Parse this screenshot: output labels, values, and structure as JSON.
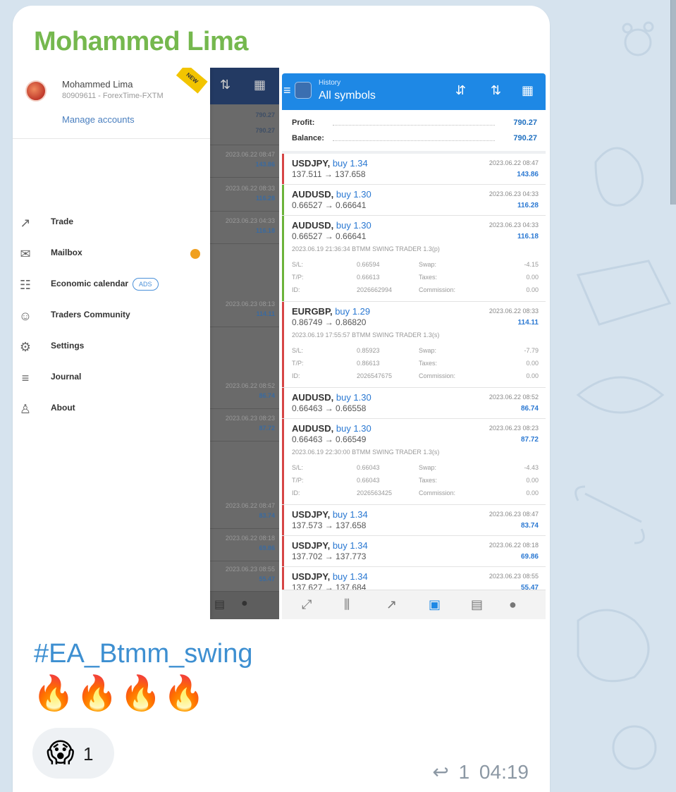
{
  "message": {
    "sender": "Mohammed Lima",
    "hashtag": "#EA_Btmm_swing",
    "emoji_line": "🔥🔥🔥🔥",
    "reaction": {
      "emoji": "😱",
      "count": "1"
    },
    "reply_icon": "↩",
    "reply_count": "1",
    "time": "04:19"
  },
  "left_screen": {
    "account": {
      "name": "Mohammed Lima",
      "number": "80909611 - ForexTime-FXTM",
      "manage_label": "Manage accounts",
      "corner_badge": "NEW"
    },
    "menu": [
      {
        "icon": "trade-icon",
        "glyph": "↗",
        "label": "Trade"
      },
      {
        "icon": "mailbox-icon",
        "glyph": "✉",
        "label": "Mailbox"
      },
      {
        "icon": "economic-calendar-icon",
        "glyph": "☷",
        "label": "Economic calendar",
        "pill": "ADS"
      },
      {
        "icon": "traders-community-icon",
        "glyph": "☺",
        "label": "Traders Community"
      },
      {
        "icon": "settings-icon",
        "glyph": "⚙",
        "label": "Settings"
      },
      {
        "icon": "journal-icon",
        "glyph": "≡",
        "label": "Journal"
      },
      {
        "icon": "about-icon",
        "glyph": "♙",
        "label": "About"
      }
    ],
    "background_values": {
      "profit": "790.27",
      "balance": "790.27",
      "rows": [
        {
          "time": "2023.06.22 08:47",
          "value": "143.86"
        },
        {
          "time": "2023.06.22 08:33",
          "value": "116.28"
        },
        {
          "time": "2023.06.23 04:33",
          "value": "116.18"
        },
        {
          "time": "2023.06.23 08:13",
          "value": "114.11"
        },
        {
          "time": "2023.06.22 08:52",
          "value": "86.74"
        },
        {
          "time": "2023.06.23 08:23",
          "value": "87.72"
        },
        {
          "time": "2023.06.22 08:47",
          "value": "83.74"
        },
        {
          "time": "2023.06.22 08:18",
          "value": "69.86"
        },
        {
          "time": "2023.06.23 08:55",
          "value": "55.47"
        }
      ]
    }
  },
  "right_screen": {
    "header": {
      "subtitle": "History",
      "title": "All symbols"
    },
    "summary": [
      {
        "label": "Profit:",
        "value": "790.27"
      },
      {
        "label": "Balance:",
        "value": "790.27"
      }
    ],
    "trades": [
      {
        "symbol": "USDJPY,",
        "side": "buy 1.34",
        "prices": "137.511 → 137.658",
        "time": "2023.06.22 08:47",
        "profit": "143.86",
        "bar": "#d64545"
      },
      {
        "symbol": "AUDUSD,",
        "side": "buy 1.30",
        "prices": "0.66527 → 0.66641",
        "time": "2023.06.23 04:33",
        "profit": "116.28",
        "bar": "#6bb33a"
      },
      {
        "symbol": "AUDUSD,",
        "side": "buy 1.30",
        "prices": "0.66527 → 0.66641",
        "time": "2023.06.23 04:33",
        "profit": "116.18",
        "bar": "#6bb33a",
        "comment": "2023.06.19 21:36:34 BTMM SWING TRADER 1.3(p)",
        "details": [
          [
            "S/L:",
            "0.66594",
            "Swap:",
            "-4.15"
          ],
          [
            "T/P:",
            "0.66613",
            "Taxes:",
            "0.00"
          ],
          [
            "ID:",
            "2026662994",
            "Commission:",
            "0.00"
          ]
        ]
      },
      {
        "symbol": "EURGBP,",
        "side": "buy 1.29",
        "prices": "0.86749 → 0.86820",
        "time": "2023.06.22 08:33",
        "profit": "114.11",
        "bar": "#d64545",
        "comment": "2023.06.19 17:55:57 BTMM SWING TRADER 1.3(s)",
        "details": [
          [
            "S/L:",
            "0.85923",
            "Swap:",
            "-7.79"
          ],
          [
            "T/P:",
            "0.86613",
            "Taxes:",
            "0.00"
          ],
          [
            "ID:",
            "2026547675",
            "Commission:",
            "0.00"
          ]
        ]
      },
      {
        "symbol": "AUDUSD,",
        "side": "buy 1.30",
        "prices": "0.66463 → 0.66558",
        "time": "2023.06.22 08:52",
        "profit": "86.74",
        "bar": "#d64545"
      },
      {
        "symbol": "AUDUSD,",
        "side": "buy 1.30",
        "prices": "0.66463 → 0.66549",
        "time": "2023.06.23 08:23",
        "profit": "87.72",
        "bar": "#d64545",
        "comment": "2023.06.19 22:30:00 BTMM SWING TRADER 1.3(s)",
        "details": [
          [
            "S/L:",
            "0.66043",
            "Swap:",
            "-4.43"
          ],
          [
            "T/P:",
            "0.66043",
            "Taxes:",
            "0.00"
          ],
          [
            "ID:",
            "2026563425",
            "Commission:",
            "0.00"
          ]
        ]
      },
      {
        "symbol": "USDJPY,",
        "side": "buy 1.34",
        "prices": "137.573 → 137.658",
        "time": "2023.06.23 08:47",
        "profit": "83.74",
        "bar": "#d64545"
      },
      {
        "symbol": "USDJPY,",
        "side": "buy 1.34",
        "prices": "137.702 → 137.773",
        "time": "2023.06.22 08:18",
        "profit": "69.86",
        "bar": "#d64545"
      },
      {
        "symbol": "USDJPY,",
        "side": "buy 1.34",
        "prices": "137.627 → 137.684",
        "time": "2023.06.23 08:55",
        "profit": "55.47",
        "bar": "#d64545"
      }
    ],
    "nav": [
      "quotes-icon",
      "chart-icon",
      "trade-icon",
      "history-icon",
      "news-icon",
      "chat-icon"
    ]
  },
  "colors": {
    "sender": "#75b84e",
    "hashtag": "#3d8fd1",
    "mt_header": "#1e88e5",
    "profit_blue": "#2a78d2"
  }
}
